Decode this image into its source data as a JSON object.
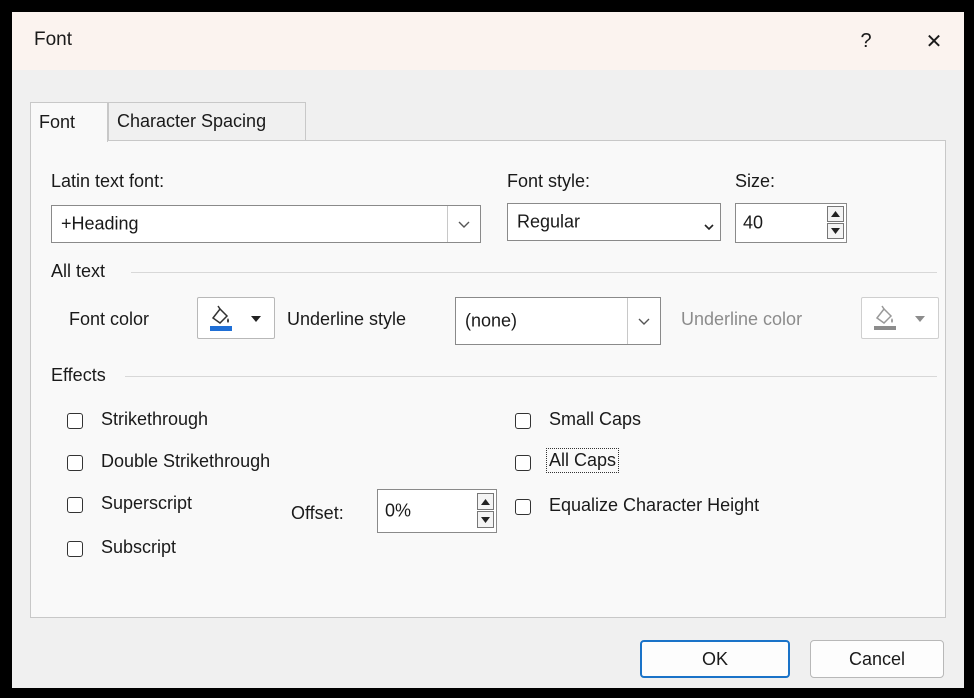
{
  "window": {
    "title": "Font"
  },
  "titlebar": {
    "help_glyph": "?",
    "close_glyph": "✕"
  },
  "tabs": [
    {
      "label": "Font",
      "active": true
    },
    {
      "label": "Character Spacing",
      "active": false
    }
  ],
  "latin_font": {
    "label": "Latin text font:",
    "value": "+Heading"
  },
  "font_style": {
    "label": "Font style:",
    "value": "Regular"
  },
  "size": {
    "label": "Size:",
    "value": "40"
  },
  "all_text": {
    "group_label": "All text",
    "font_color_label": "Font color",
    "underline_style_label": "Underline style",
    "underline_style_value": "(none)",
    "underline_color_label": "Underline color"
  },
  "effects": {
    "group_label": "Effects",
    "strikethrough": "Strikethrough",
    "double_strikethrough": "Double Strikethrough",
    "superscript": "Superscript",
    "subscript": "Subscript",
    "small_caps": "Small Caps",
    "all_caps": "All Caps",
    "equalize": "Equalize Character Height",
    "offset_label": "Offset:",
    "offset_value": "0%"
  },
  "buttons": {
    "ok": "OK",
    "cancel": "Cancel"
  },
  "colors": {
    "font_color_swatch": "#1f6fd6",
    "underline_color_swatch": "#8c8c8c",
    "primary_border": "#1a73c8"
  }
}
